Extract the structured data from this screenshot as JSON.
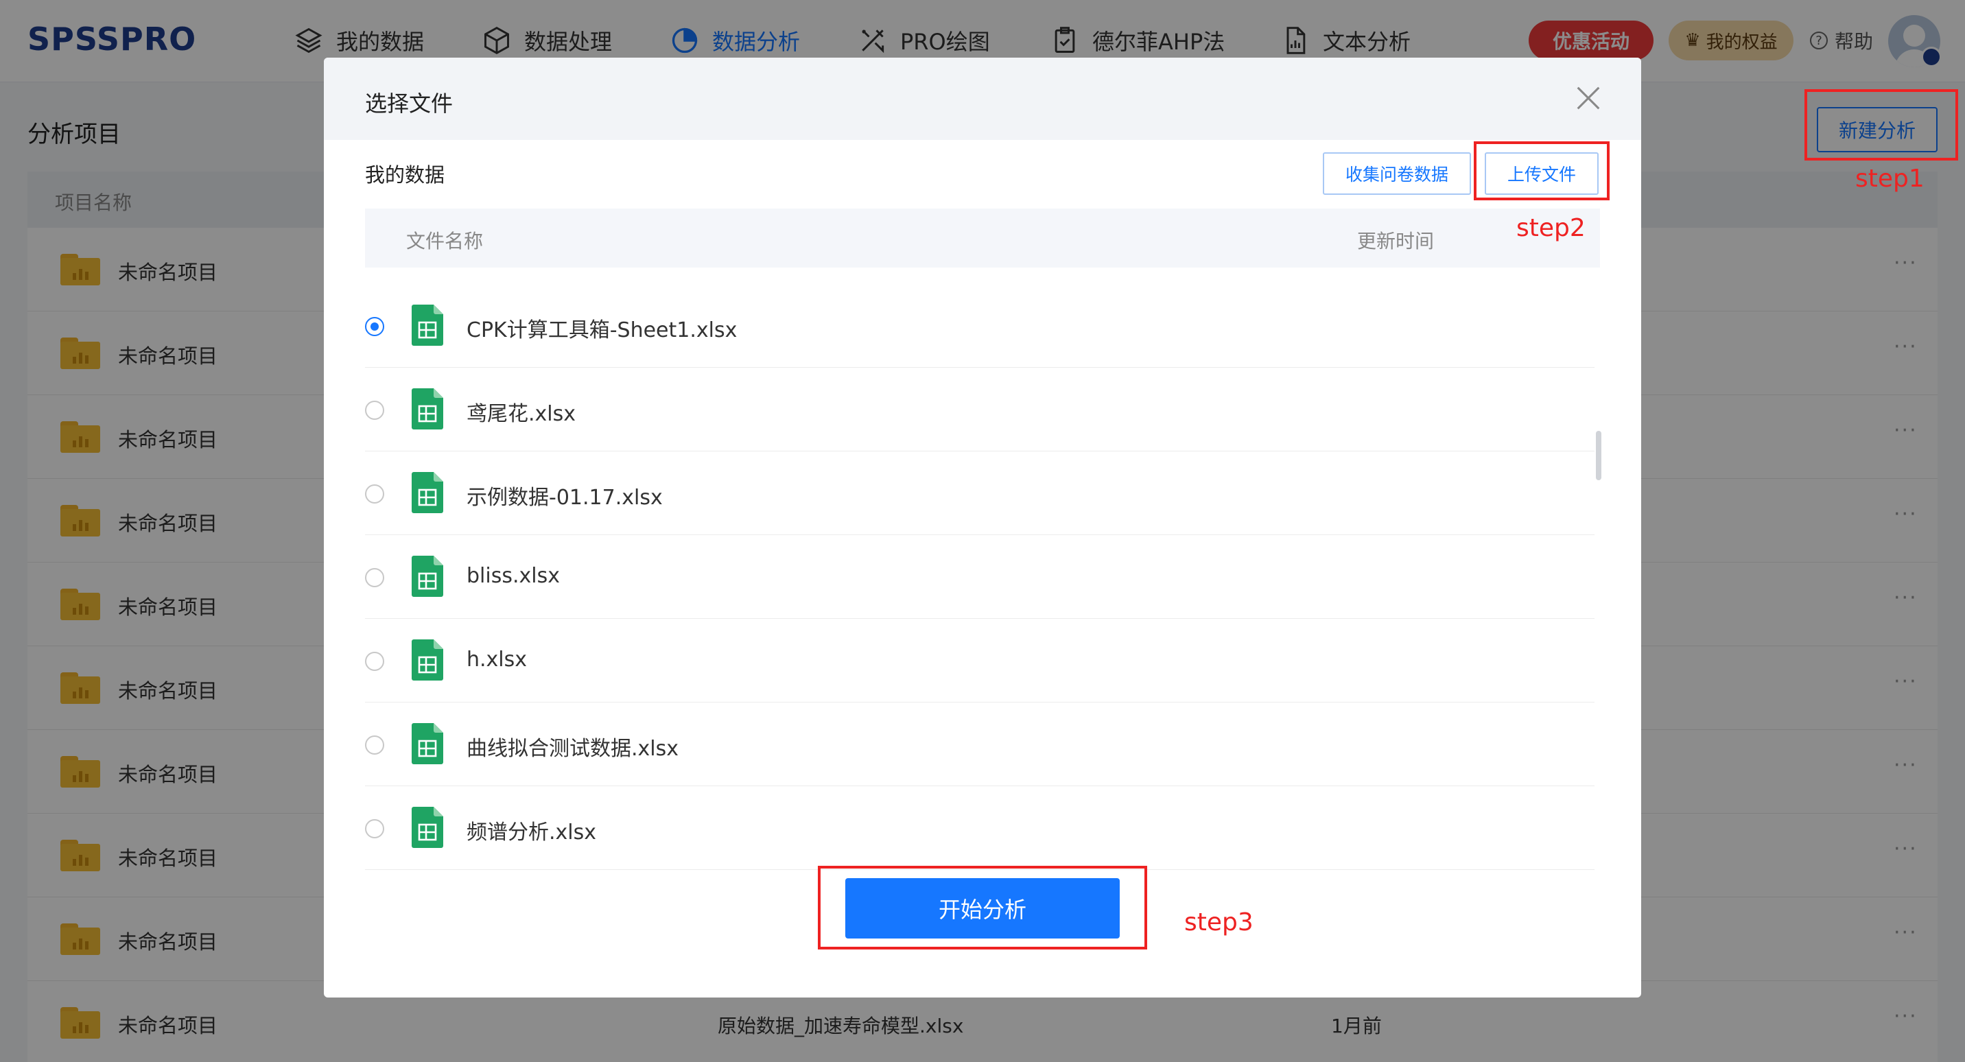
{
  "app": {
    "logo": "SPSSPRO"
  },
  "nav": {
    "items": [
      {
        "label": "我的数据",
        "icon": "layers-icon"
      },
      {
        "label": "数据处理",
        "icon": "cube-icon"
      },
      {
        "label": "数据分析",
        "icon": "pie-chart-icon",
        "active": true
      },
      {
        "label": "PRO绘图",
        "icon": "draw-tools-icon"
      },
      {
        "label": "德尔菲AHP法",
        "icon": "clipboard-check-icon"
      },
      {
        "label": "文本分析",
        "icon": "document-chart-icon"
      }
    ],
    "promo": "优惠活动",
    "rights": "我的权益",
    "help": "帮助"
  },
  "page": {
    "title": "分析项目",
    "new_button": "新建分析",
    "column_name": "项目名称",
    "project_name": "未命名项目",
    "last_row_file": "原始数据_加速寿命模型.xlsx",
    "last_row_time": "1月前",
    "more": "···"
  },
  "modal": {
    "title": "选择文件",
    "section_title": "我的数据",
    "collect_button": "收集问卷数据",
    "upload_button": "上传文件",
    "col_name": "文件名称",
    "col_time": "更新时间",
    "files": [
      {
        "name": "CPK计算工具箱-Sheet1.xlsx",
        "selected": true
      },
      {
        "name": "鸢尾花.xlsx",
        "selected": false
      },
      {
        "name": "示例数据-01.17.xlsx",
        "selected": false
      },
      {
        "name": "bliss.xlsx",
        "selected": false
      },
      {
        "name": "h.xlsx",
        "selected": false
      },
      {
        "name": "曲线拟合测试数据.xlsx",
        "selected": false
      },
      {
        "name": "频谱分析.xlsx",
        "selected": false
      }
    ],
    "start_button": "开始分析"
  },
  "annotations": {
    "step1": "step1",
    "step2": "step2",
    "step3": "step3",
    "color": "#ee2222"
  },
  "colors": {
    "accent": "#1677ff",
    "brand": "#1e3c8c",
    "promo": "#ef3b3b",
    "sheet_icon": "#1fa463"
  }
}
